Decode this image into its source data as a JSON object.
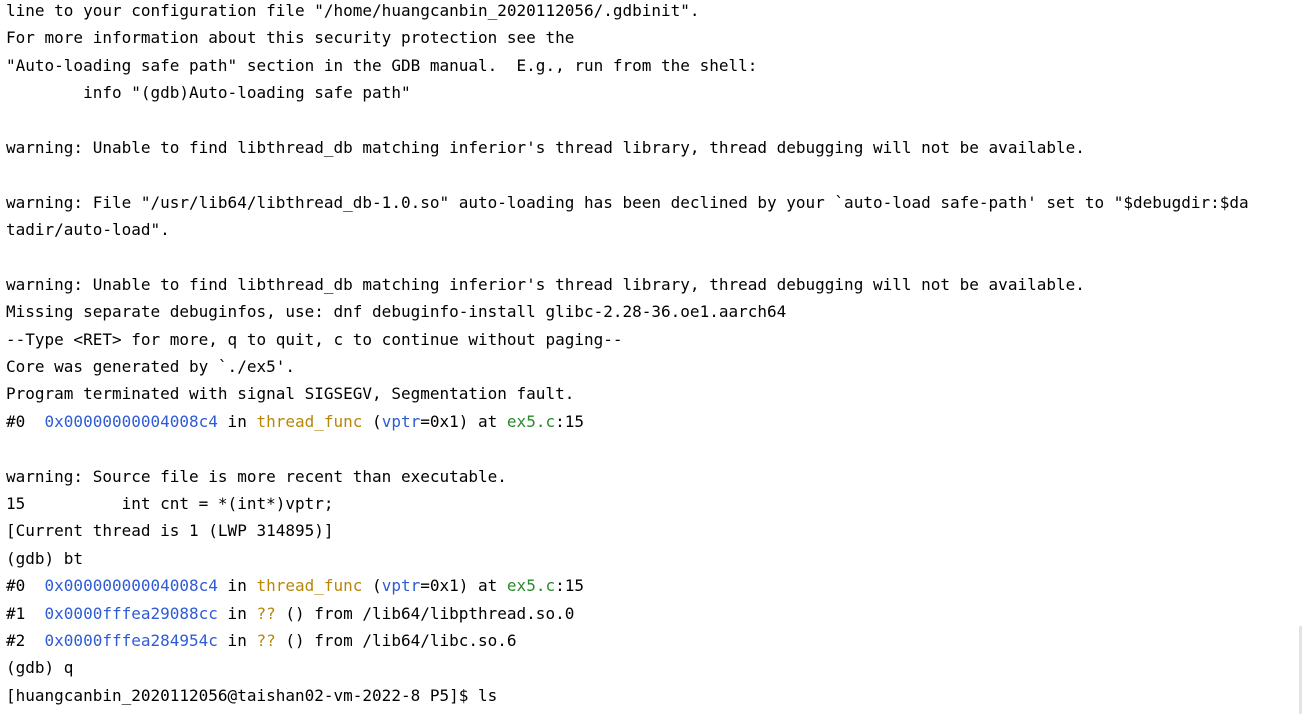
{
  "lines": {
    "l0": "line to your configuration file \"/home/huangcanbin_2020112056/.gdbinit\".",
    "l1": "For more information about this security protection see the",
    "l2": "\"Auto-loading safe path\" section in the GDB manual.  E.g., run from the shell:",
    "l3": "        info \"(gdb)Auto-loading safe path\"",
    "l5": "warning: Unable to find libthread_db matching inferior's thread library, thread debugging will not be available.",
    "l7": "warning: File \"/usr/lib64/libthread_db-1.0.so\" auto-loading has been declined by your `auto-load safe-path' set to \"$debugdir:$da",
    "l8": "tadir/auto-load\".",
    "l10": "warning: Unable to find libthread_db matching inferior's thread library, thread debugging will not be available.",
    "l11": "Missing separate debuginfos, use: dnf debuginfo-install glibc-2.28-36.oe1.aarch64",
    "l12": "--Type <RET> for more, q to quit, c to continue without paging--",
    "l13": "Core was generated by `./ex5'.",
    "l14": "Program terminated with signal SIGSEGV, Segmentation fault.",
    "l17": "warning: Source file is more recent than executable.",
    "l18": "15          int cnt = *(int*)vptr;",
    "l19": "[Current thread is 1 (LWP 314895)]",
    "l20": "(gdb) bt",
    "l24": "(gdb) q",
    "l25": "[huangcanbin_2020112056@taishan02-vm-2022-8 P5]$ ls"
  },
  "frames": [
    {
      "num": "#0",
      "addr": "0x00000000004008c4",
      "in": " in ",
      "func": "thread_func",
      "lp": " (",
      "arg": "vptr",
      "argval": "=0x1)",
      "at": " at ",
      "file": "ex5.c",
      "lineno": ":15"
    },
    {
      "num": "#0",
      "addr": "0x00000000004008c4",
      "in": " in ",
      "func": "thread_func",
      "lp": " (",
      "arg": "vptr",
      "argval": "=0x1)",
      "at": " at ",
      "file": "ex5.c",
      "lineno": ":15"
    },
    {
      "num": "#1",
      "addr": "0x0000fffea29088cc",
      "in": " in ",
      "func": "??",
      "rest": " () from /lib64/libpthread.so.0"
    },
    {
      "num": "#2",
      "addr": "0x0000fffea284954c",
      "in": " in ",
      "func": "??",
      "rest": " () from /lib64/libc.so.6"
    }
  ],
  "colors": {
    "address": "#2e5bd6",
    "function": "#b8860b",
    "file": "#2a8a2a",
    "text": "#000000",
    "background": "#ffffff"
  }
}
